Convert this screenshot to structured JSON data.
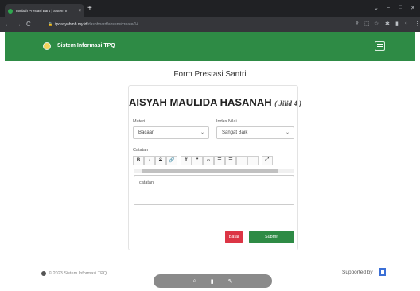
{
  "browser": {
    "tab_title": "Tambah Prestasi Baru | Sistem In",
    "tab_close": "×",
    "new_tab": "+",
    "window_controls": [
      "⌄",
      "–",
      "□",
      "✕"
    ],
    "nav": [
      "←",
      "→",
      "C"
    ],
    "url_host": "tpqasyahmh.my.id",
    "url_path": "/dashboard/absens/create/14",
    "toolbar_icons": [
      "share-icon",
      "bookmark-icon",
      "star-icon",
      "extension-icon",
      "sidebar-icon",
      "profile-icon",
      "menu-icon"
    ]
  },
  "app": {
    "brand": "Sistem Informasi TPQ",
    "accent": "#2e8b45"
  },
  "page": {
    "title": "Form Prestasi Santri"
  },
  "form": {
    "student_name": "AISYAH MAULIDA HASANAH",
    "jilid": "( Jilid 4 )",
    "materi_label": "Materi",
    "materi_value": "Bacaan",
    "nilai_label": "Index Nilai",
    "nilai_value": "Sangat Baik",
    "catatan_label": "Catatan",
    "catatan_value": "catatan",
    "toolbar": [
      "B",
      "I",
      "S",
      "🔗",
      "ff",
      "❞",
      "‹›",
      "☰",
      "☰",
      "",
      "",
      "⤢"
    ],
    "cancel_label": "Batal",
    "submit_label": "Submit"
  },
  "footer": {
    "copyright": "© 2023 Sistem Informasi TPQ",
    "supported_by": "Supported by :"
  },
  "bottom_bar": {
    "icons": [
      "home-icon",
      "trash-icon",
      "edit-icon"
    ]
  }
}
